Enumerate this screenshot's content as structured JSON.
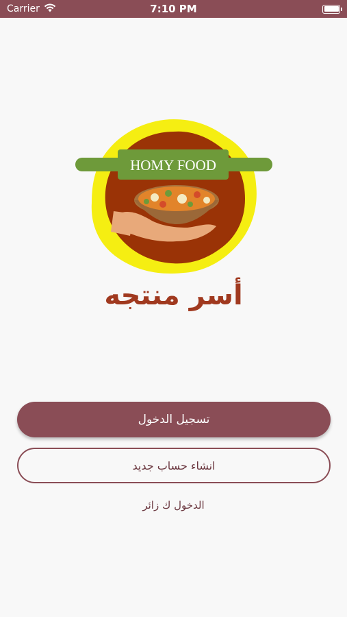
{
  "status_bar": {
    "carrier": "Carrier",
    "time": "7:10 PM"
  },
  "logo": {
    "banner_text": "HOMY FOOD",
    "title": "أسر منتجه",
    "colors": {
      "outer_glow": "#f5ee12",
      "inner_circle": "#9a3306",
      "banner": "#6e9a3a",
      "title": "#a0391f"
    }
  },
  "actions": {
    "login_label": "تسجيل الدخول",
    "register_label": "انشاء حساب جديد",
    "guest_label": "الدخول ك زائر"
  },
  "theme": {
    "primary": "#8a4d56",
    "background": "#f8f8f8"
  }
}
